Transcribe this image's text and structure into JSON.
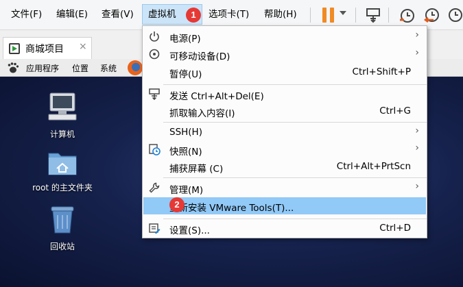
{
  "menubar": {
    "items": [
      "文件(F)",
      "编辑(E)",
      "查看(V)",
      "虚拟机(M)",
      "选项卡(T)",
      "帮助(H)"
    ],
    "active_label": "虚拟机"
  },
  "badges": [
    "1",
    "2"
  ],
  "tab": {
    "label": "商城项目",
    "close": "×"
  },
  "guest_panel": {
    "items": [
      "应用程序",
      "位置",
      "系统"
    ]
  },
  "desktop": {
    "icons": [
      "计算机",
      "root 的主文件夹",
      "回收站"
    ]
  },
  "context_menu": {
    "items": [
      {
        "label": "电源(P)",
        "shortcut": "",
        "submenu": true,
        "icon": "power-icon"
      },
      {
        "label": "可移动设备(D)",
        "shortcut": "",
        "submenu": true,
        "icon": "removable-devices-icon"
      },
      {
        "label": "暂停(U)",
        "shortcut": "Ctrl+Shift+P",
        "submenu": false,
        "icon": ""
      },
      {
        "label": "发送 Ctrl+Alt+Del(E)",
        "shortcut": "",
        "submenu": false,
        "icon": "send-keys-icon"
      },
      {
        "label": "抓取输入内容(I)",
        "shortcut": "Ctrl+G",
        "submenu": false,
        "icon": ""
      },
      {
        "label": "SSH(H)",
        "shortcut": "",
        "submenu": true,
        "icon": ""
      },
      {
        "label": "快照(N)",
        "shortcut": "",
        "submenu": true,
        "icon": "snapshot-icon"
      },
      {
        "label": "捕获屏幕 (C)",
        "shortcut": "Ctrl+Alt+PrtScn",
        "submenu": false,
        "icon": ""
      },
      {
        "label": "管理(M)",
        "shortcut": "",
        "submenu": true,
        "icon": "wrench-icon"
      },
      {
        "label": "重新安装 VMware Tools(T)...",
        "shortcut": "",
        "submenu": false,
        "icon": "",
        "highlighted": true
      },
      {
        "label": "设置(S)...",
        "shortcut": "Ctrl+D",
        "submenu": false,
        "icon": "settings-icon"
      }
    ]
  },
  "colors": {
    "accent": "#f08a24",
    "highlight": "#91c9f7",
    "badge": "#e53935",
    "active_menu": "#cce4f7"
  }
}
